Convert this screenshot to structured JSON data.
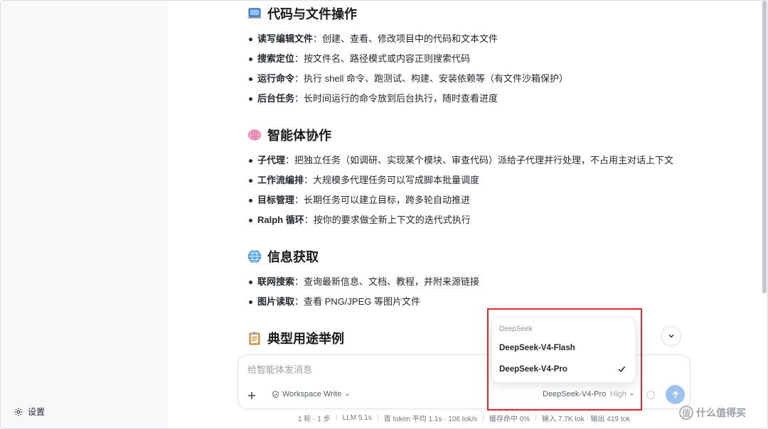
{
  "sidebar": {
    "settings_label": "设置"
  },
  "sections": [
    {
      "icon": "laptop-icon",
      "title": "代码与文件操作",
      "items": [
        {
          "term": "读写编辑文件",
          "desc": "：创建、查看、修改项目中的代码和文本文件"
        },
        {
          "term": "搜索定位",
          "desc": "：按文件名、路径模式或内容正则搜索代码"
        },
        {
          "term": "运行命令",
          "desc": "：执行 shell 命令、跑测试、构建、安装依赖等（有文件沙箱保护）"
        },
        {
          "term": "后台任务",
          "desc": "：长时间运行的命令放到后台执行，随时查看进度"
        }
      ]
    },
    {
      "icon": "brain-icon",
      "title": "智能体协作",
      "items": [
        {
          "term": "子代理",
          "desc": "：把独立任务（如调研、实现某个模块、审查代码）派给子代理并行处理，不占用主对话上下文"
        },
        {
          "term": "工作流编排",
          "desc": "：大规模多代理任务可以写成脚本批量调度"
        },
        {
          "term": "目标管理",
          "desc": "：长期任务可以建立目标，跨多轮自动推进"
        },
        {
          "term": "Ralph 循环",
          "desc": "：按你的要求做全新上下文的迭代式执行"
        }
      ]
    },
    {
      "icon": "globe-icon",
      "title": "信息获取",
      "items": [
        {
          "term": "联网搜索",
          "desc": "：查询最新信息、文档、教程，并附来源链接"
        },
        {
          "term": "图片读取",
          "desc": "：查看 PNG/JPEG 等图片文件"
        }
      ]
    },
    {
      "icon": "clipboard-icon",
      "title": "典型用途举例",
      "items": []
    }
  ],
  "composer": {
    "placeholder": "给智能体发消息",
    "workspace_label": "Workspace Write",
    "model_label": "DeepSeek-V4-Pro",
    "effort_label": "High"
  },
  "model_dropdown": {
    "group_label": "DeepSeek",
    "options": [
      {
        "label": "DeepSeek-V4-Flash",
        "selected": false
      },
      {
        "label": "DeepSeek-V4-Pro",
        "selected": true
      }
    ]
  },
  "status_bar": [
    "1 轮 · 1 步",
    "LLM 5.1s",
    "首 token 平均 1.1s · 106 tok/s",
    "缓存命中 0%",
    "输入 7.7K tok · 输出 419 tok"
  ],
  "watermark": {
    "badge": "值",
    "text": "什么值得买"
  },
  "colors": {
    "accent_send": "#9cc2ef",
    "highlight_border": "#e2252b"
  }
}
